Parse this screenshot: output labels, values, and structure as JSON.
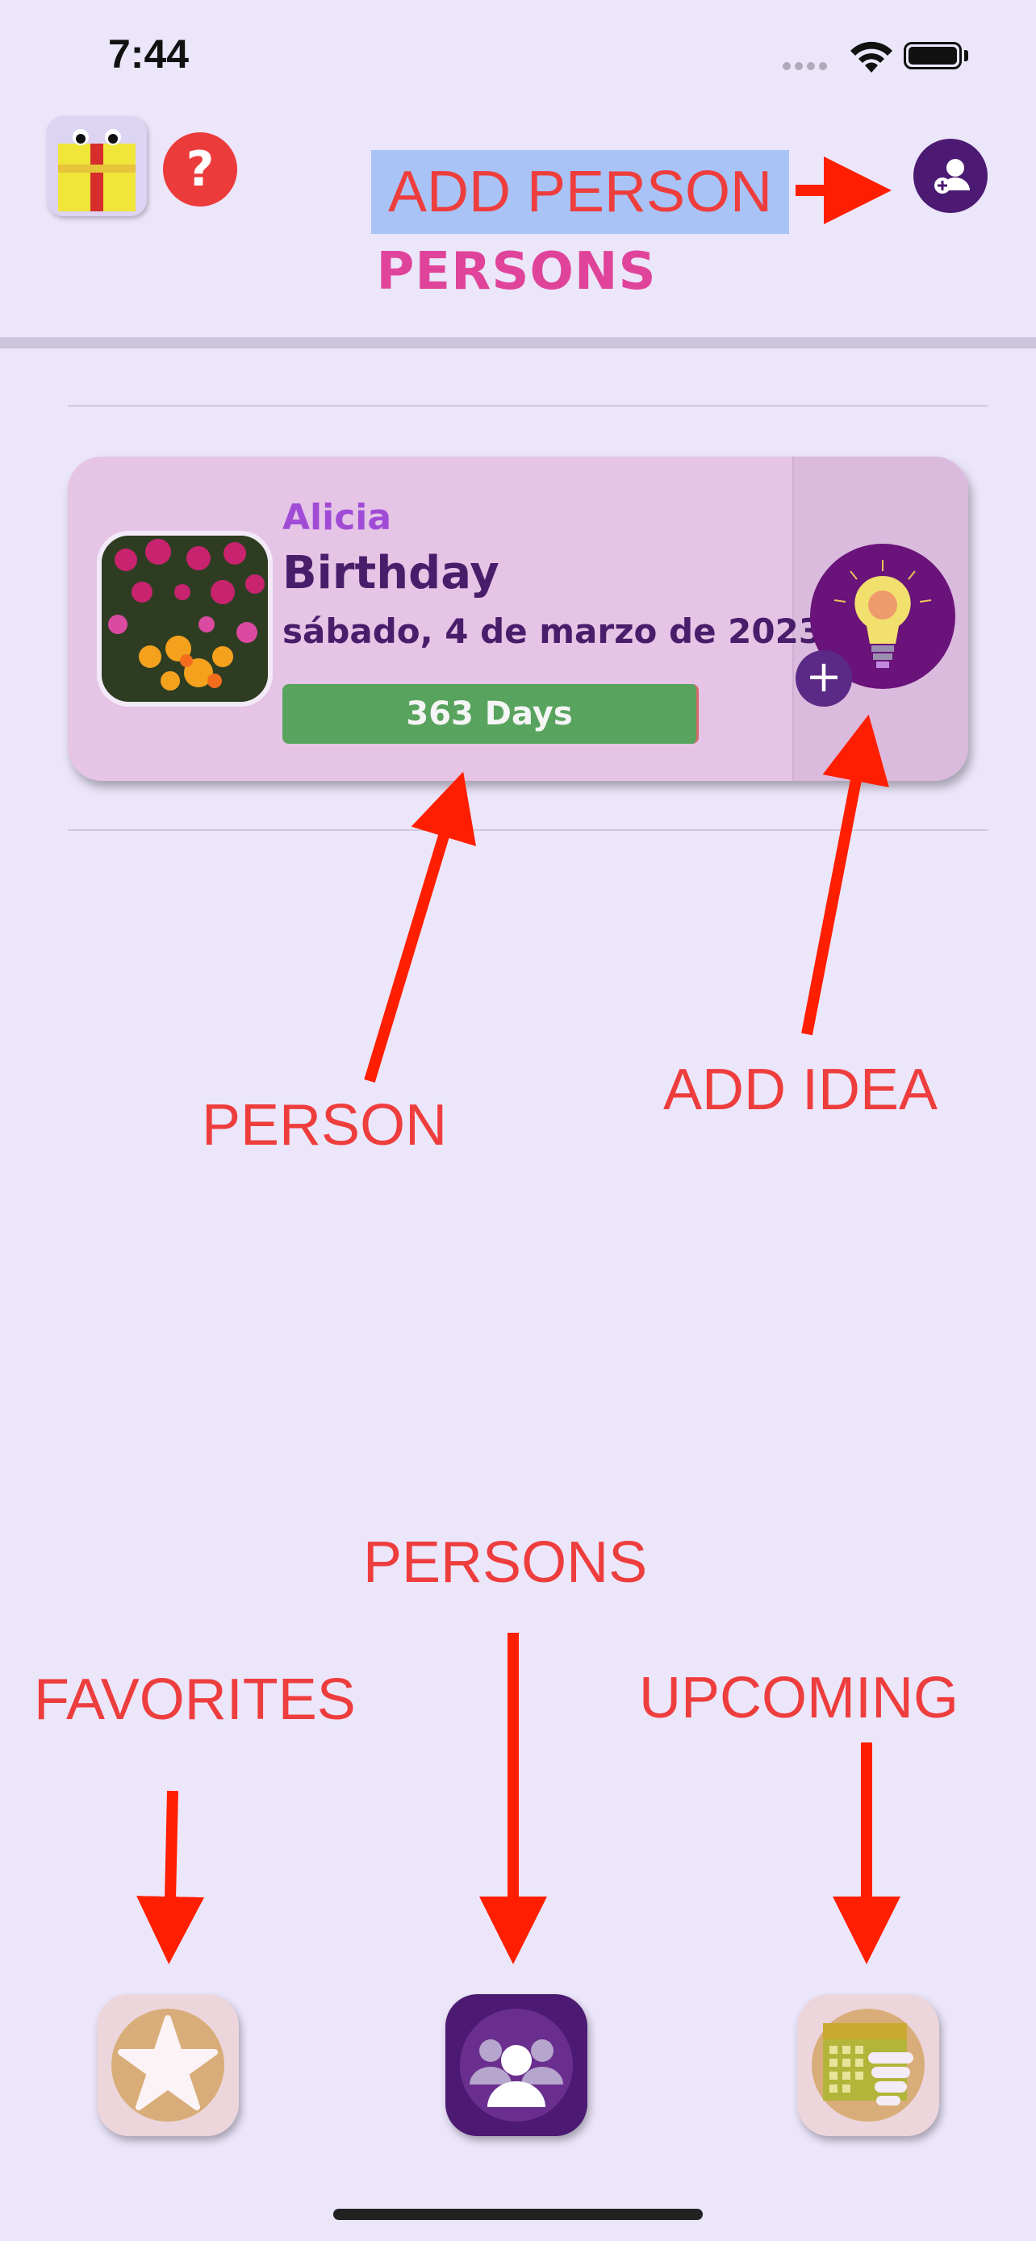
{
  "status_bar": {
    "time": "7:44"
  },
  "header": {
    "help_label": "?",
    "title_annotation": "ADD PERSON",
    "page_title": "PERSONS"
  },
  "card": {
    "name": "Alicia",
    "event": "Birthday",
    "date": "sábado, 4 de marzo de 2023",
    "days_remaining": "363 Days",
    "add_idea_label": "+"
  },
  "annotations": {
    "person": "PERSON",
    "add_idea": "ADD IDEA",
    "persons": "PERSONS",
    "favorites": "FAVORITES",
    "upcoming": "UPCOMING"
  },
  "tabs": [
    {
      "name": "favorites",
      "icon": "star-icon"
    },
    {
      "name": "persons",
      "icon": "people-icon"
    },
    {
      "name": "upcoming",
      "icon": "calendar-icon"
    }
  ],
  "colors": {
    "background": "#ece6fb",
    "accent_purple": "#4c1a72",
    "annotation_red": "#ee3d3d",
    "title_pink": "#e0449a",
    "days_green": "#58a35e"
  }
}
